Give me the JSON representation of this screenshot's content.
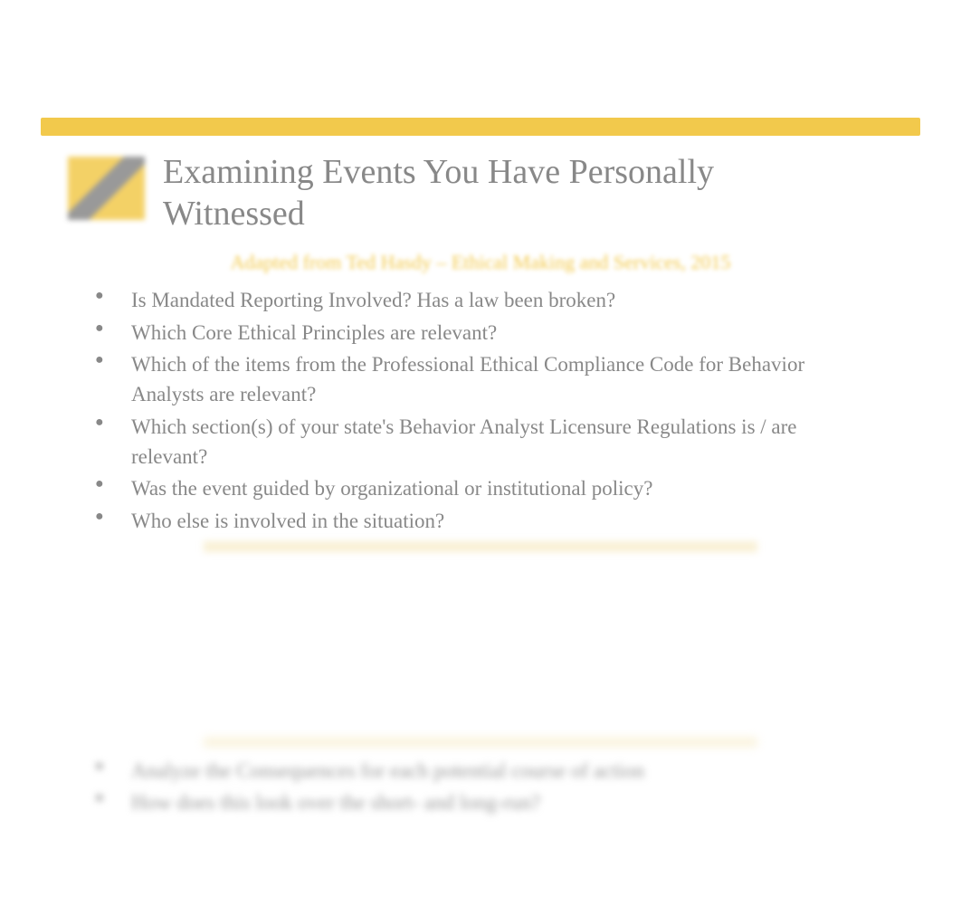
{
  "slide": {
    "title": "Examining Events You Have Personally Witnessed",
    "subtitle": "Adapted from Ted Hasdy – Ethical Making and Services, 2015",
    "bullets": [
      "Is Mandated Reporting Involved? Has a law been broken?",
      "Which Core Ethical Principles are relevant?",
      "Which of the items from the Professional Ethical Compliance Code for Behavior Analysts are relevant?",
      "Which section(s) of your state's Behavior Analyst Licensure Regulations is / are relevant?",
      "Was the event guided by organizational or institutional policy?",
      "Who else is involved in the situation?"
    ]
  },
  "blurred": {
    "bullets": [
      "Analyze the Consequences for each potential course of action",
      "How does this look over the short- and long-run?"
    ]
  },
  "colors": {
    "accent": "#f2c94c",
    "text": "#888888"
  }
}
